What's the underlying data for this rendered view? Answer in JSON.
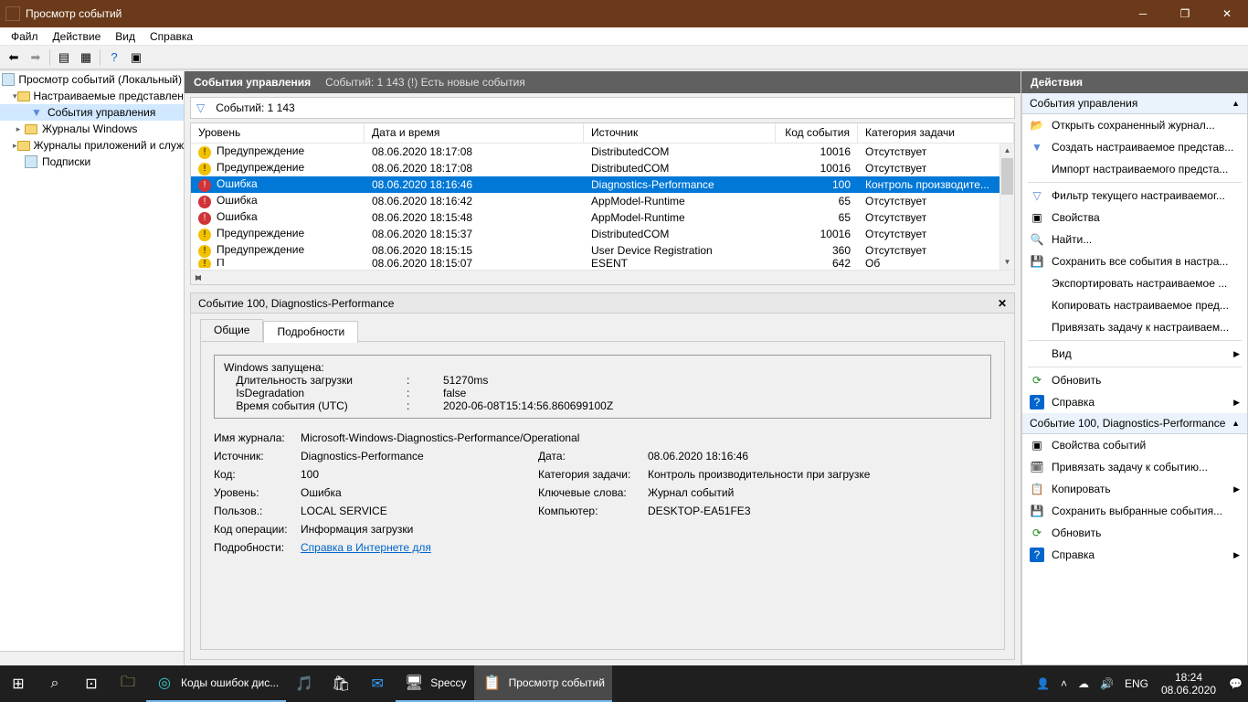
{
  "window": {
    "title": "Просмотр событий"
  },
  "menubar": {
    "file": "Файл",
    "action": "Действие",
    "view": "Вид",
    "help": "Справка"
  },
  "tree": {
    "root": "Просмотр событий (Локальный)",
    "custom_views": "Настраиваемые представления",
    "admin_events": "События управления",
    "windows_logs": "Журналы Windows",
    "app_logs": "Журналы приложений и служб",
    "subscriptions": "Подписки"
  },
  "center": {
    "header_label": "События управления",
    "header_info": "Событий: 1 143 (!) Есть новые события",
    "filter_count": "Событий: 1 143",
    "columns": {
      "level": "Уровень",
      "date": "Дата и время",
      "source": "Источник",
      "code": "Код события",
      "category": "Категория задачи"
    },
    "rows": [
      {
        "lvl": "warn",
        "level": "Предупреждение",
        "date": "08.06.2020 18:17:08",
        "source": "DistributedCOM",
        "code": "10016",
        "cat": "Отсутствует"
      },
      {
        "lvl": "warn",
        "level": "Предупреждение",
        "date": "08.06.2020 18:17:08",
        "source": "DistributedCOM",
        "code": "10016",
        "cat": "Отсутствует"
      },
      {
        "lvl": "error",
        "level": "Ошибка",
        "date": "08.06.2020 18:16:46",
        "source": "Diagnostics-Performance",
        "code": "100",
        "cat": "Контроль производите...",
        "selected": true
      },
      {
        "lvl": "error",
        "level": "Ошибка",
        "date": "08.06.2020 18:16:42",
        "source": "AppModel-Runtime",
        "code": "65",
        "cat": "Отсутствует"
      },
      {
        "lvl": "error",
        "level": "Ошибка",
        "date": "08.06.2020 18:15:48",
        "source": "AppModel-Runtime",
        "code": "65",
        "cat": "Отсутствует"
      },
      {
        "lvl": "warn",
        "level": "Предупреждение",
        "date": "08.06.2020 18:15:37",
        "source": "DistributedCOM",
        "code": "10016",
        "cat": "Отсутствует"
      },
      {
        "lvl": "warn",
        "level": "Предупреждение",
        "date": "08.06.2020 18:15:15",
        "source": "User Device Registration",
        "code": "360",
        "cat": "Отсутствует"
      }
    ],
    "partial_row": {
      "level": "П",
      "date": "08.06.2020 18:15:07",
      "source": "ESENT",
      "code": "642",
      "cat": "Об"
    }
  },
  "detail": {
    "header": "Событие 100, Diagnostics-Performance",
    "tab_general": "Общие",
    "tab_details": "Подробности",
    "msg_title": "Windows запущена:",
    "msg_l1_k": "    Длительность загрузки",
    "msg_l1_c": ":",
    "msg_l1_v": "51270ms",
    "msg_l2_k": "    IsDegradation",
    "msg_l2_c": ":",
    "msg_l2_v": "false",
    "msg_l3_k": "    Время события (UTC)",
    "msg_l3_c": ":",
    "msg_l3_v": "2020-06-08T15:14:56.860699100Z",
    "props": {
      "log_name_l": "Имя журнала:",
      "log_name_v": "Microsoft-Windows-Diagnostics-Performance/Operational",
      "source_l": "Источник:",
      "source_v": "Diagnostics-Performance",
      "date_l": "Дата:",
      "date_v": "08.06.2020 18:16:46",
      "code_l": "Код:",
      "code_v": "100",
      "cat_l": "Категория задачи:",
      "cat_v": "Контроль производительности при загрузке",
      "level_l": "Уровень:",
      "level_v": "Ошибка",
      "keywords_l": "Ключевые слова:",
      "keywords_v": "Журнал событий",
      "user_l": "Пользов.:",
      "user_v": "LOCAL SERVICE",
      "computer_l": "Компьютер:",
      "computer_v": "DESKTOP-EA51FE3",
      "opcode_l": "Код операции:",
      "opcode_v": "Информация загрузки",
      "details_l": "Подробности:",
      "details_link": "Справка в Интернете для "
    }
  },
  "actions": {
    "title": "Действия",
    "section1": "События управления",
    "open_saved": "Открыть сохраненный журнал...",
    "create_view": "Создать настраиваемое представ...",
    "import_view": "Импорт настраиваемого предста...",
    "filter_log": "Фильтр текущего настраиваемог...",
    "properties": "Свойства",
    "find": "Найти...",
    "save_all": "Сохранить все события в настра...",
    "export_view": "Экспортировать настраиваемое ...",
    "copy_view": "Копировать настраиваемое пред...",
    "attach_task": "Привязать задачу к настраиваем...",
    "view": "Вид",
    "refresh": "Обновить",
    "help": "Справка",
    "section2": "Событие 100, Diagnostics-Performance",
    "event_props": "Свойства событий",
    "attach_task_event": "Привязать задачу к событию...",
    "copy": "Копировать",
    "save_selected": "Сохранить выбранные события...",
    "refresh2": "Обновить",
    "help2": "Справка"
  },
  "taskbar": {
    "edge_label": "Коды ошибок дис...",
    "speccy": "Speccy",
    "eventvwr": "Просмотр событий",
    "lang": "ENG",
    "time": "18:24",
    "date": "08.06.2020"
  }
}
